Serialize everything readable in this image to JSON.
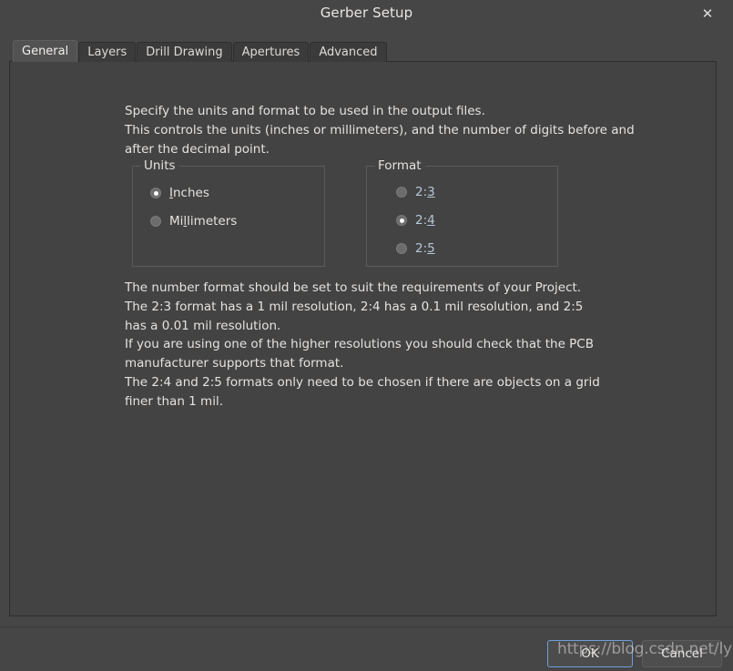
{
  "window": {
    "title": "Gerber Setup",
    "close_icon": "close-icon",
    "close_glyph": "✕"
  },
  "tabs": [
    {
      "label": "General",
      "active": true
    },
    {
      "label": "Layers",
      "active": false
    },
    {
      "label": "Drill Drawing",
      "active": false
    },
    {
      "label": "Apertures",
      "active": false
    },
    {
      "label": "Advanced",
      "active": false
    }
  ],
  "general": {
    "intro_text": "Specify the units and format to be used in the output files.\nThis controls the units (inches or millimeters), and the number of digits before and after the decimal point.",
    "units": {
      "title": "Units",
      "options": [
        {
          "label": "Inches",
          "mnemonic": "I",
          "selected": true
        },
        {
          "label": "Millimeters",
          "mnemonic": "l",
          "selected": false
        }
      ]
    },
    "format": {
      "title": "Format",
      "options": [
        {
          "label": "2:3",
          "mnemonic": "3",
          "selected": false
        },
        {
          "label": "2:4",
          "mnemonic": "4",
          "selected": true
        },
        {
          "label": "2:5",
          "mnemonic": "5",
          "selected": false
        }
      ]
    },
    "notes_text": "The number format should be set to suit the requirements of your Project.\nThe 2:3 format has a 1 mil resolution, 2:4 has a 0.1 mil resolution, and 2:5 has a 0.01 mil resolution.\nIf you are using one of the higher resolutions you should check that the PCB manufacturer supports that format.\nThe 2:4 and 2:5 formats only need to be chosen if there are objects on a grid finer than 1 mil."
  },
  "footer": {
    "ok_label": "OK",
    "cancel_label": "Cancel"
  },
  "watermark": {
    "text": "https://blog.csdn.net/lyrjj"
  },
  "colors": {
    "window_bg": "#464646",
    "panel_bg": "#434343",
    "tab_inactive_bg": "#3b3b3b",
    "tab_active_bg": "#525252",
    "text": "#e6e2df",
    "link_text": "#b8c6d8",
    "focus_border": "#6f9fd8"
  }
}
